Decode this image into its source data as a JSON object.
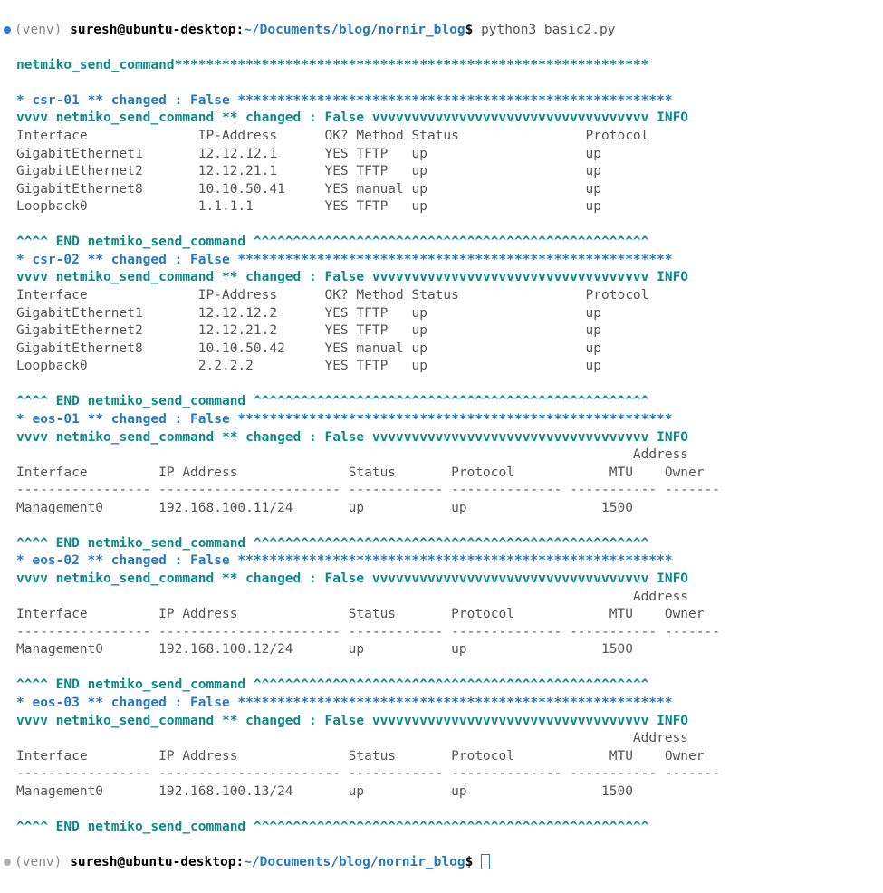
{
  "prompt1": {
    "venv": "(venv) ",
    "userhost": "suresh@ubuntu-desktop",
    "colon": ":",
    "path": "~/Documents/blog/nornir_blog",
    "dollar": "$",
    "cmd": " python3 basic2.py"
  },
  "task_line": "netmiko_send_command************************************************************",
  "hosts": [
    {
      "header": "* csr-01 ** changed : False *******************************************************",
      "vvvv": "vvvv netmiko_send_command ** changed : False vvvvvvvvvvvvvvvvvvvvvvvvvvvvvvvvvvv INFO",
      "body": "Interface              IP-Address      OK? Method Status                Protocol\nGigabitEthernet1       12.12.12.1      YES TFTP   up                    up\nGigabitEthernet2       12.12.21.1      YES TFTP   up                    up\nGigabitEthernet8       10.10.50.41     YES manual up                    up\nLoopback0              1.1.1.1         YES TFTP   up                    up\n",
      "end": "^^^^ END netmiko_send_command ^^^^^^^^^^^^^^^^^^^^^^^^^^^^^^^^^^^^^^^^^^^^^^^^^^"
    },
    {
      "header": "* csr-02 ** changed : False *******************************************************",
      "vvvv": "vvvv netmiko_send_command ** changed : False vvvvvvvvvvvvvvvvvvvvvvvvvvvvvvvvvvv INFO",
      "body": "Interface              IP-Address      OK? Method Status                Protocol\nGigabitEthernet1       12.12.12.2      YES TFTP   up                    up\nGigabitEthernet2       12.12.21.2      YES TFTP   up                    up\nGigabitEthernet8       10.10.50.42     YES manual up                    up\nLoopback0              2.2.2.2         YES TFTP   up                    up\n",
      "end": "^^^^ END netmiko_send_command ^^^^^^^^^^^^^^^^^^^^^^^^^^^^^^^^^^^^^^^^^^^^^^^^^^"
    },
    {
      "header": "* eos-01 ** changed : False *******************************************************",
      "vvvv": "vvvv netmiko_send_command ** changed : False vvvvvvvvvvvvvvvvvvvvvvvvvvvvvvvvvvv INFO",
      "body": "                                                                              Address\nInterface         IP Address              Status       Protocol            MTU    Owner\n----------------- ----------------------- ------------ -------------- ----------- -------\nManagement0       192.168.100.11/24       up           up                 1500\n",
      "end": "^^^^ END netmiko_send_command ^^^^^^^^^^^^^^^^^^^^^^^^^^^^^^^^^^^^^^^^^^^^^^^^^^"
    },
    {
      "header": "* eos-02 ** changed : False *******************************************************",
      "vvvv": "vvvv netmiko_send_command ** changed : False vvvvvvvvvvvvvvvvvvvvvvvvvvvvvvvvvvv INFO",
      "body": "                                                                              Address\nInterface         IP Address              Status       Protocol            MTU    Owner\n----------------- ----------------------- ------------ -------------- ----------- -------\nManagement0       192.168.100.12/24       up           up                 1500\n",
      "end": "^^^^ END netmiko_send_command ^^^^^^^^^^^^^^^^^^^^^^^^^^^^^^^^^^^^^^^^^^^^^^^^^^"
    },
    {
      "header": "* eos-03 ** changed : False *******************************************************",
      "vvvv": "vvvv netmiko_send_command ** changed : False vvvvvvvvvvvvvvvvvvvvvvvvvvvvvvvvvvv INFO",
      "body": "                                                                              Address\nInterface         IP Address              Status       Protocol            MTU    Owner\n----------------- ----------------------- ------------ -------------- ----------- -------\nManagement0       192.168.100.13/24       up           up                 1500\n",
      "end": "^^^^ END netmiko_send_command ^^^^^^^^^^^^^^^^^^^^^^^^^^^^^^^^^^^^^^^^^^^^^^^^^^"
    }
  ],
  "prompt2": {
    "venv": "(venv) ",
    "userhost": "suresh@ubuntu-desktop",
    "colon": ":",
    "path": "~/Documents/blog/nornir_blog",
    "dollar": "$"
  }
}
